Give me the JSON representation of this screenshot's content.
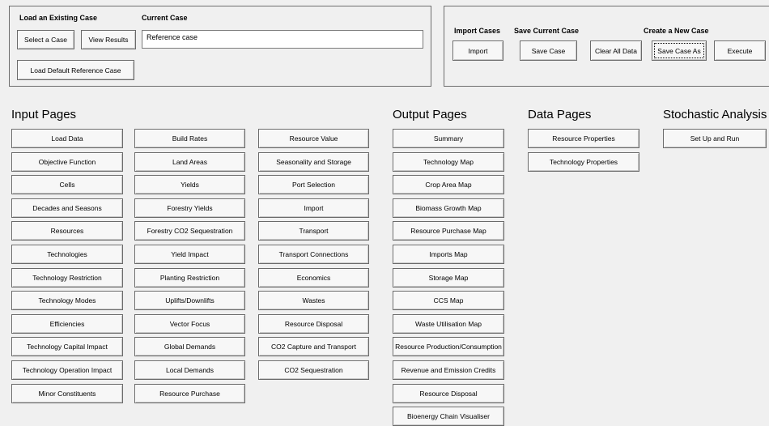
{
  "load_existing": {
    "heading": "Load an Existing Case",
    "select_label": "Select a Case",
    "view_results_label": "View Results",
    "load_default_label": "Load Default Reference Case"
  },
  "current_case": {
    "heading": "Current Case",
    "value": "Reference case"
  },
  "import_cases": {
    "heading": "Import Cases",
    "button_label": "Import"
  },
  "save_current": {
    "heading": "Save Current Case",
    "button_label": "Save Case"
  },
  "create_new": {
    "heading": "Create a New Case",
    "clear_label": "Clear All Data",
    "save_as_label": "Save Case As",
    "execute_label": "Execute"
  },
  "input_pages": {
    "heading": "Input Pages",
    "col1": [
      "Load Data",
      "Objective Function",
      "Cells",
      "Decades and Seasons",
      "Resources",
      "Technologies",
      "Technology Restriction",
      "Technology Modes",
      "Efficiencies",
      "Technology Capital Impact",
      "Technology Operation Impact",
      "Minor Constituents"
    ],
    "col2": [
      "Build Rates",
      "Land Areas",
      "Yields",
      "Forestry Yields",
      "Forestry CO2 Sequestration",
      "Yield Impact",
      "Planting Restriction",
      "Uplifts/Downlifts",
      "Vector Focus",
      "Global Demands",
      "Local Demands",
      "Resource Purchase"
    ],
    "col3": [
      "Resource Value",
      "Seasonality and Storage",
      "Port Selection",
      "Import",
      "Transport",
      "Transport Connections",
      "Economics",
      "Wastes",
      "Resource Disposal",
      "CO2 Capture and Transport",
      "CO2 Sequestration"
    ]
  },
  "output_pages": {
    "heading": "Output Pages",
    "items": [
      "Summary",
      "Technology Map",
      "Crop Area Map",
      "Biomass Growth Map",
      "Resource Purchase Map",
      "Imports Map",
      "Storage Map",
      "CCS Map",
      "Waste Utilisation Map",
      "Resource Production/Consumption",
      "Revenue and Emission Credits",
      "Resource Disposal",
      "Bioenergy Chain Visualiser"
    ]
  },
  "data_pages": {
    "heading": "Data Pages",
    "items": [
      "Resource Properties",
      "Technology Properties"
    ]
  },
  "stochastic": {
    "heading": "Stochastic Analysis",
    "items": [
      "Set Up and Run"
    ]
  }
}
